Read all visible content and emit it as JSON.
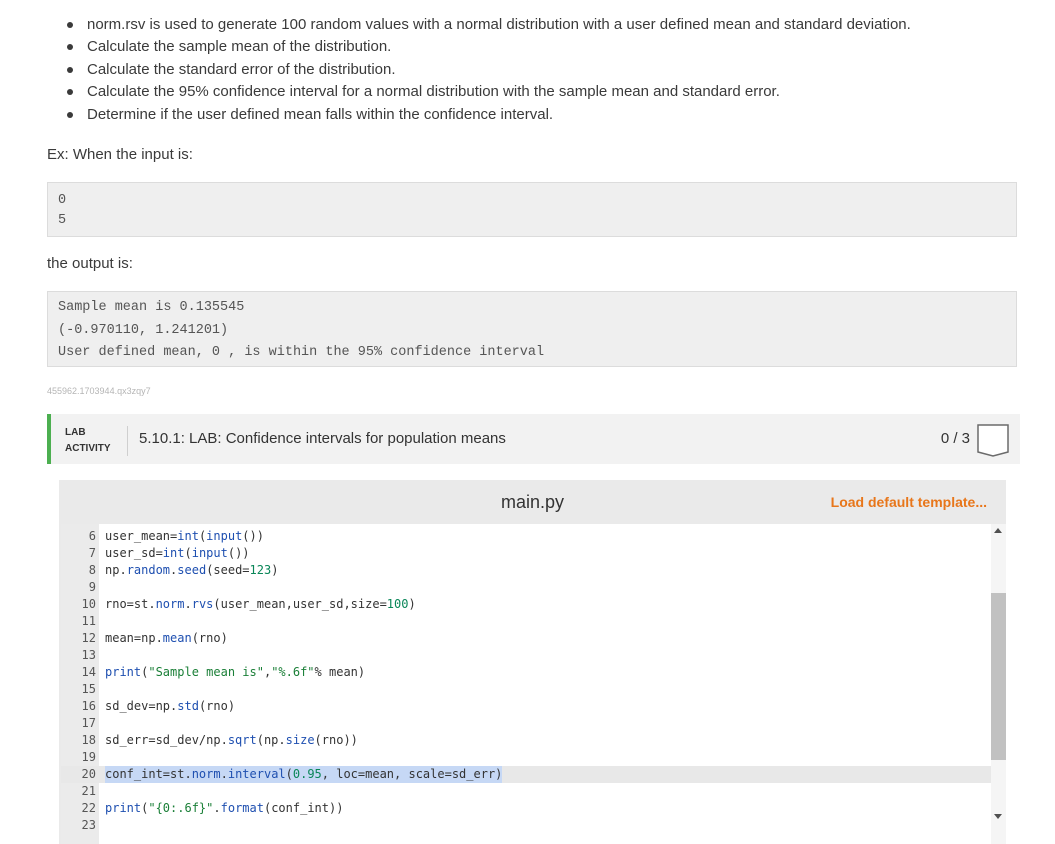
{
  "instructions": {
    "bullets": [
      "norm.rsv is used to generate 100 random values with a normal distribution with a user defined mean and standard deviation.",
      "Calculate the sample mean of the distribution.",
      "Calculate the standard error of the distribution.",
      "Calculate the 95% confidence interval for a normal distribution with the sample mean and standard error.",
      "Determine if the user defined mean falls within the confidence interval."
    ],
    "example_intro": "Ex: When the input is:",
    "input_lines": [
      "0",
      "5"
    ],
    "output_intro": "the output is:",
    "output_lines": [
      "Sample mean is 0.135545",
      "(-0.970110, 1.241201)",
      "User defined mean, 0 , is within the 95% confidence interval"
    ],
    "problem_id": "455962.1703944.qx3zqy7"
  },
  "lab": {
    "tag_line1": "LAB",
    "tag_line2": "ACTIVITY",
    "title": "5.10.1: LAB: Confidence intervals for population means",
    "score": "0 / 3",
    "accent_color": "#4caf50"
  },
  "editor": {
    "filename": "main.py",
    "load_template_label": "Load default template...",
    "load_color": "#e8761a",
    "lines": [
      {
        "num": "6",
        "text": "user_mean=int(input())"
      },
      {
        "num": "7",
        "text": "user_sd=int(input())"
      },
      {
        "num": "8",
        "text": "np.random.seed(seed=123)"
      },
      {
        "num": "9",
        "text": ""
      },
      {
        "num": "10",
        "text": "rno=st.norm.rvs(user_mean,user_sd,size=100)"
      },
      {
        "num": "11",
        "text": ""
      },
      {
        "num": "12",
        "text": "mean=np.mean(rno)"
      },
      {
        "num": "13",
        "text": ""
      },
      {
        "num": "14",
        "text": "print(\"Sample mean is\",\"%.6f\"% mean)"
      },
      {
        "num": "15",
        "text": ""
      },
      {
        "num": "16",
        "text": "sd_dev=np.std(rno)"
      },
      {
        "num": "17",
        "text": ""
      },
      {
        "num": "18",
        "text": "sd_err=sd_dev/np.sqrt(np.size(rno))"
      },
      {
        "num": "19",
        "text": ""
      },
      {
        "num": "20",
        "text": "conf_int=st.norm.interval(0.95, loc=mean, scale=sd_err)"
      },
      {
        "num": "21",
        "text": ""
      },
      {
        "num": "22",
        "text": "print(\"{0:.6f}\".format(conf_int))"
      },
      {
        "num": "23",
        "text": ""
      }
    ],
    "active_line": "20"
  }
}
